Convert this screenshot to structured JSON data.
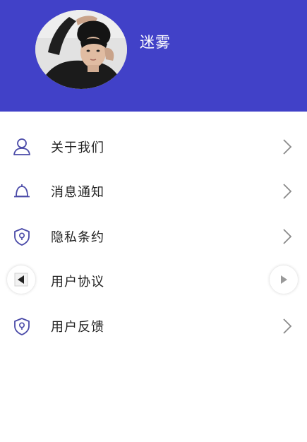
{
  "colors": {
    "brand": "#4141c8",
    "icon": "#4a4aa8",
    "text": "#222222",
    "chevron": "#8a8a8a"
  },
  "profile": {
    "username": "迷雾",
    "avatar_icon": "user-avatar-photo"
  },
  "menu": {
    "items": [
      {
        "label": "关于我们",
        "icon": "person-icon"
      },
      {
        "label": "消息通知",
        "icon": "bell-icon"
      },
      {
        "label": "隐私条约",
        "icon": "shield-icon"
      },
      {
        "label": "用户协议",
        "icon": ""
      },
      {
        "label": "用户反馈",
        "icon": "shield-icon"
      }
    ]
  },
  "nav": {
    "prev_icon": "triangle-left-icon",
    "next_icon": "triangle-right-icon"
  }
}
